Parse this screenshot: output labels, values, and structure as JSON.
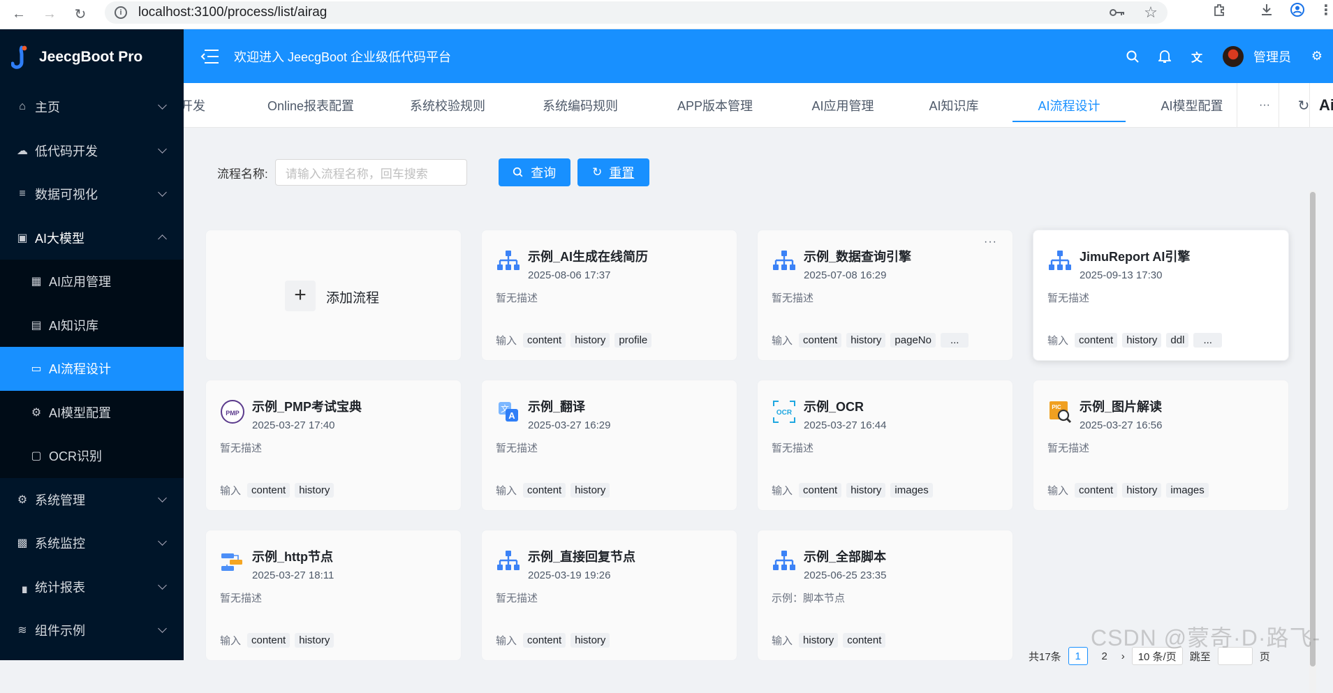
{
  "browser": {
    "url": "localhost:3100/process/list/airag"
  },
  "app": {
    "name": "JeecgBoot Pro",
    "welcome": "欢迎进入 JeecgBoot 企业级低代码平台",
    "user": "管理员",
    "accent": "#1890ff",
    "sidebar_bg": "#001529"
  },
  "sidebar": {
    "items": [
      {
        "label": "主页",
        "icon": "home-icon"
      },
      {
        "label": "低代码开发",
        "icon": "cloud-icon"
      },
      {
        "label": "数据可视化",
        "icon": "chart-icon"
      },
      {
        "label": "AI大模型",
        "icon": "robot-icon"
      },
      {
        "label": "AI应用管理",
        "icon": "grid-icon"
      },
      {
        "label": "AI知识库",
        "icon": "book-icon"
      },
      {
        "label": "AI流程设计",
        "icon": "flow-icon"
      },
      {
        "label": "AI模型配置",
        "icon": "gear-icon"
      },
      {
        "label": "OCR识别",
        "icon": "scan-icon"
      },
      {
        "label": "系统管理",
        "icon": "settings-icon"
      },
      {
        "label": "系统监控",
        "icon": "monitor-icon"
      },
      {
        "label": "统计报表",
        "icon": "bar-chart-icon"
      },
      {
        "label": "组件示例",
        "icon": "layers-icon"
      }
    ]
  },
  "tabs": {
    "items": [
      "开发",
      "Online报表配置",
      "系统校验规则",
      "系统编码规则",
      "APP版本管理",
      "AI应用管理",
      "AI知识库",
      "AI流程设计",
      "AI模型配置"
    ],
    "more": "···",
    "partial_right": "Ai"
  },
  "search": {
    "label": "流程名称:",
    "placeholder": "请输入流程名称，回车搜索",
    "query_label": "查询",
    "reset_label": "重置"
  },
  "add_card": {
    "label": "添加流程"
  },
  "input_label": "输入",
  "cards": [
    {
      "title": "示例_AI生成在线简历",
      "date": "2025-08-06 17:37",
      "desc": "暂无描述",
      "tags": [
        "content",
        "history",
        "profile"
      ],
      "icon": "flow-icon"
    },
    {
      "title": "示例_数据查询引擎",
      "date": "2025-07-08 16:29",
      "desc": "暂无描述",
      "tags": [
        "content",
        "history",
        "pageNo",
        "..."
      ],
      "icon": "flow-icon",
      "more": "···"
    },
    {
      "title": "JimuReport AI引擎",
      "date": "2025-09-13 17:30",
      "desc": "暂无描述",
      "tags": [
        "content",
        "history",
        "ddl",
        "..."
      ],
      "icon": "flow-icon"
    },
    {
      "title": "示例_PMP考试宝典",
      "date": "2025-03-27 17:40",
      "desc": "暂无描述",
      "tags": [
        "content",
        "history"
      ],
      "icon": "pmp-icon",
      "icon_text": "PMP"
    },
    {
      "title": "示例_翻译",
      "date": "2025-03-27 16:29",
      "desc": "暂无描述",
      "tags": [
        "content",
        "history"
      ],
      "icon": "translate-icon"
    },
    {
      "title": "示例_OCR",
      "date": "2025-03-27 16:44",
      "desc": "暂无描述",
      "tags": [
        "content",
        "history",
        "images"
      ],
      "icon": "ocr-icon",
      "icon_text": "OCR"
    },
    {
      "title": "示例_图片解读",
      "date": "2025-03-27 16:56",
      "desc": "暂无描述",
      "tags": [
        "content",
        "history",
        "images"
      ],
      "icon": "pic-icon",
      "icon_text": "PIC"
    },
    {
      "title": "示例_http节点",
      "date": "2025-03-27 18:11",
      "desc": "暂无描述",
      "tags": [
        "content",
        "history"
      ],
      "icon": "http-icon"
    },
    {
      "title": "示例_直接回复节点",
      "date": "2025-03-19 19:26",
      "desc": "暂无描述",
      "tags": [
        "content",
        "history"
      ],
      "icon": "flow-icon"
    },
    {
      "title": "示例_全部脚本",
      "date": "2025-06-25 23:35",
      "desc": "示例：脚本节点",
      "tags": [
        "history",
        "content"
      ],
      "icon": "flow-icon"
    }
  ],
  "pager": {
    "total": "共17条",
    "pages": [
      "1",
      "2"
    ],
    "size": "10 条/页",
    "goto": "跳至",
    "page_suffix": "页"
  },
  "watermark": "CSDN @蒙奇·D·路飞-"
}
